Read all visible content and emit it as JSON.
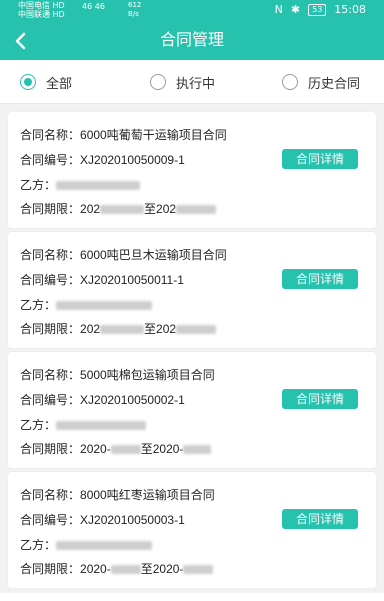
{
  "status_bar": {
    "carrier_1": "中国电信 HD",
    "carrier_2": "中国联通 HD",
    "network": "46 46",
    "speed_value": "612",
    "speed_unit": "B/s",
    "battery": "53",
    "time": "15:08"
  },
  "header": {
    "title": "合同管理"
  },
  "filters": [
    {
      "label": "全部",
      "checked": true
    },
    {
      "label": "执行中",
      "checked": false
    },
    {
      "label": "历史合同",
      "checked": false
    }
  ],
  "labels": {
    "name": "合同名称：",
    "number": "合同编号：",
    "party_b": "乙方：",
    "period": "合同期限：",
    "detail_button": "合同详情"
  },
  "contracts": [
    {
      "name": "6000吨葡萄干运输项目合同",
      "number": "XJ202010050009-1",
      "period_start": "202",
      "period_sep": "至202"
    },
    {
      "name": "6000吨巴旦木运输项目合同",
      "number": "XJ202010050011-1",
      "period_start": "202",
      "period_sep": "至202"
    },
    {
      "name": "5000吨棉包运输项目合同",
      "number": "XJ202010050002-1",
      "period_start": "2020-",
      "period_sep": "至2020-"
    },
    {
      "name": "8000吨红枣运输项目合同",
      "number": "XJ202010050003-1",
      "period_start": "2020-",
      "period_sep": "至2020-"
    }
  ],
  "colors": {
    "accent": "#26c2ad"
  }
}
